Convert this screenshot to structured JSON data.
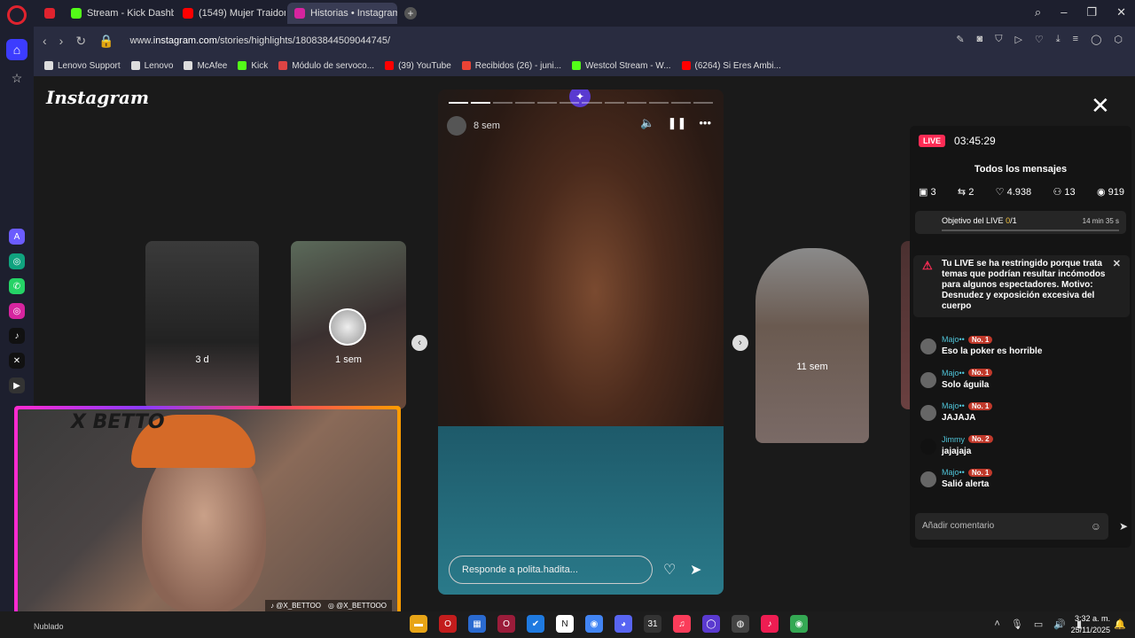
{
  "tabs": [
    {
      "label": "",
      "color": "#e0232e"
    },
    {
      "label": "Stream - Kick Dashboard",
      "color": "#53fc18"
    },
    {
      "label": "(1549) Mujer Traidora - Ar",
      "color": "#ff0000"
    },
    {
      "label": "Historias • Instagram",
      "color": "#d6249f"
    }
  ],
  "address": {
    "url_prefix": "www.",
    "url_domain": "instagram.com",
    "url_path": "/stories/highlights/18083844509044745/"
  },
  "bookmarks": [
    {
      "label": "Lenovo Support",
      "color": "#dddddd"
    },
    {
      "label": "Lenovo",
      "color": "#dddddd"
    },
    {
      "label": "McAfee",
      "color": "#dddddd"
    },
    {
      "label": "Kick",
      "color": "#53fc18"
    },
    {
      "label": "Módulo de servoco...",
      "color": "#d44"
    },
    {
      "label": "(39) YouTube",
      "color": "#ff0000"
    },
    {
      "label": "Recibidos (26) - juni...",
      "color": "#ea4335"
    },
    {
      "label": "Westcol Stream - W...",
      "color": "#53fc18"
    },
    {
      "label": "(6264) Si Eres Ambi...",
      "color": "#ff0000"
    }
  ],
  "instagram": {
    "logo": "Instagram",
    "side_stories": [
      {
        "time": "3 d"
      },
      {
        "time": "1 sem"
      },
      {
        "time": "11 sem"
      }
    ],
    "story": {
      "time": "8 sem",
      "reply_placeholder": "Responde a polita.hadita...",
      "progress_total": 12,
      "progress_done": 2
    }
  },
  "chat": {
    "live": "LIVE",
    "timer": "03:45:29",
    "all_messages": "Todos los mensajes",
    "stats": [
      "3",
      "2",
      "4.938",
      "13",
      "919"
    ],
    "goal_label": "Objetivo del LIVE",
    "goal_current": "0",
    "goal_total": "/1",
    "goal_time": "14 min 35 s",
    "warning": "Tu LIVE se ha restringido porque trata temas que podrían resultar incómodos para algunos espectadores. Motivo: Desnudez y exposición excesiva del cuerpo",
    "messages": [
      {
        "user": "Majo••",
        "rank": "No. 1",
        "text": "Eso la poker es horrible"
      },
      {
        "user": "Majo••",
        "rank": "No. 1",
        "text": "Solo águila"
      },
      {
        "user": "Majo••",
        "rank": "No. 1",
        "text": "JAJAJA"
      },
      {
        "user": "Jimmy",
        "rank": "No. 2",
        "text": "jajajaja"
      },
      {
        "user": "Majo••",
        "rank": "No. 1",
        "text": "Salió alerta"
      }
    ],
    "comment_placeholder": "Añadir comentario"
  },
  "webcam": {
    "title": "X BETTO",
    "tiktok": "@X_BETTOO",
    "instagram": "@X_BETTOOO"
  },
  "taskbar": {
    "weather": "Nublado",
    "time": "3:32 a. m.",
    "date": "25/11/2025"
  }
}
